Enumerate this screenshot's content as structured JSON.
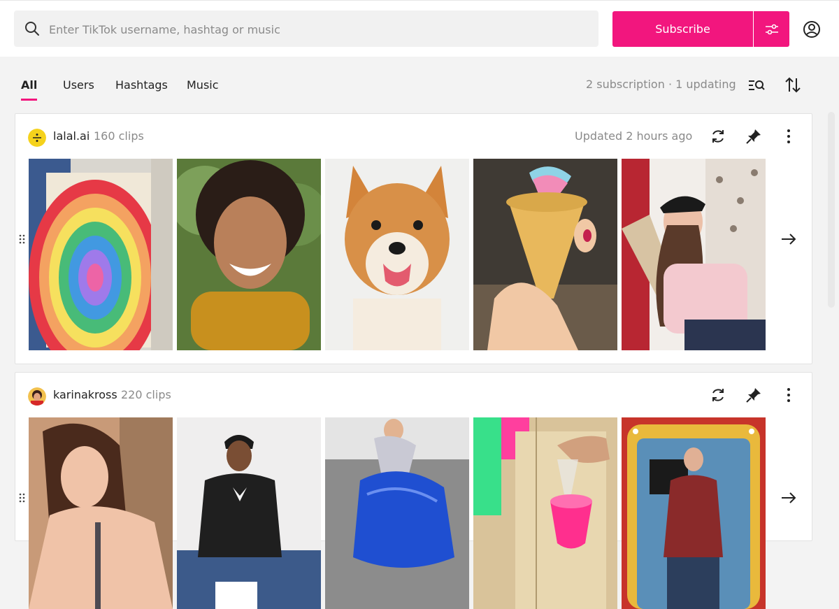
{
  "search": {
    "placeholder": "Enter TikTok username, hashtag or music",
    "value": ""
  },
  "header": {
    "subscribe_label": "Subscribe"
  },
  "tabs": [
    {
      "label": "All",
      "active": true
    },
    {
      "label": "Users",
      "active": false
    },
    {
      "label": "Hashtags",
      "active": false
    },
    {
      "label": "Music",
      "active": false
    }
  ],
  "summary": "2 subscription · 1 updating",
  "icons": {
    "search": "search-icon",
    "filter": "sliders-icon",
    "account": "user-circle-icon",
    "search_list": "list-search-icon",
    "sort": "sort-arrows-icon",
    "refresh": "refresh-icon",
    "pin": "pin-icon",
    "more": "more-vertical-icon",
    "next": "arrow-right-icon",
    "drag": "drag-handle-icon"
  },
  "colors": {
    "accent": "#f2167e",
    "muted_text": "#8a8a8a"
  },
  "subscriptions": [
    {
      "name": "lalal.ai",
      "count": "160 clips",
      "updated": "Updated 2 hours ago",
      "thumbs": [
        "rainbow spiral wall art",
        "smiling person in yellow sweater",
        "shiba inu dog",
        "ice cream cone",
        "person with cricket bat"
      ]
    },
    {
      "name": "karinakross",
      "count": "220 clips",
      "updated": "",
      "thumbs": [
        "woman sitting",
        "man in tuxedo t-shirt",
        "person with blue tarp",
        "pink bucket",
        "man on stage"
      ]
    }
  ]
}
